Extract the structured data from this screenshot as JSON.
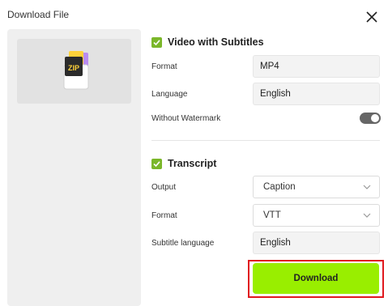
{
  "dialog": {
    "title": "Download File"
  },
  "thumbnail": {
    "icon_text": "ZIP"
  },
  "video_section": {
    "title": "Video with Subtitles",
    "checked": true,
    "format_label": "Format",
    "format_value": "MP4",
    "language_label": "Language",
    "language_value": "English",
    "watermark_label": "Without Watermark",
    "watermark_enabled": true
  },
  "transcript_section": {
    "title": "Transcript",
    "checked": true,
    "output_label": "Output",
    "output_value": "Caption",
    "format_label": "Format",
    "format_value": "VTT",
    "subtitle_language_label": "Subtitle language",
    "subtitle_language_value": "English"
  },
  "actions": {
    "download_label": "Download"
  },
  "colors": {
    "accent": "#99ee00",
    "checkbox": "#7bb72a",
    "highlight": "#e0191f"
  }
}
